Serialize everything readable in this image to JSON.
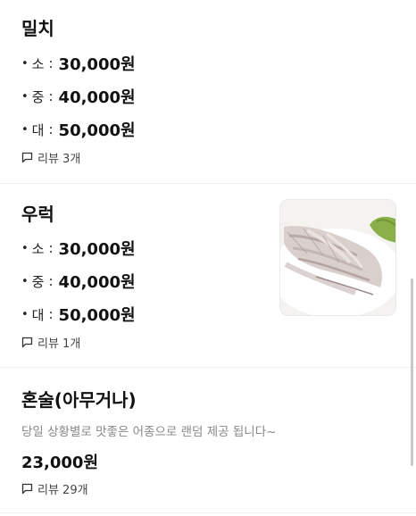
{
  "menu": {
    "items": [
      {
        "name": "밀치",
        "prices": [
          {
            "bullet": "•",
            "size": "소",
            "sep": ":",
            "amount": "30,000원"
          },
          {
            "bullet": "•",
            "size": "중",
            "sep": ":",
            "amount": "40,000원"
          },
          {
            "bullet": "•",
            "size": "대",
            "sep": ":",
            "amount": "50,000원"
          }
        ],
        "review": "리뷰 3개"
      },
      {
        "name": "우럭",
        "prices": [
          {
            "bullet": "•",
            "size": "소",
            "sep": ":",
            "amount": "30,000원"
          },
          {
            "bullet": "•",
            "size": "중",
            "sep": ":",
            "amount": "40,000원"
          },
          {
            "bullet": "•",
            "size": "대",
            "sep": ":",
            "amount": "50,000원"
          }
        ],
        "review": "리뷰 1개"
      },
      {
        "name": "혼술(아무거나)",
        "description": "당일 상황별로 맛좋은 어종으로 랜덤 제공 됩니다~",
        "price": "23,000원",
        "review": "리뷰 29개"
      }
    ]
  },
  "colors": {
    "text": "#111111",
    "muted": "#888888",
    "divider": "#eeeeee",
    "scrollbar": "#c8c8c8"
  },
  "icons": {
    "review": "speech-bubble-icon"
  }
}
